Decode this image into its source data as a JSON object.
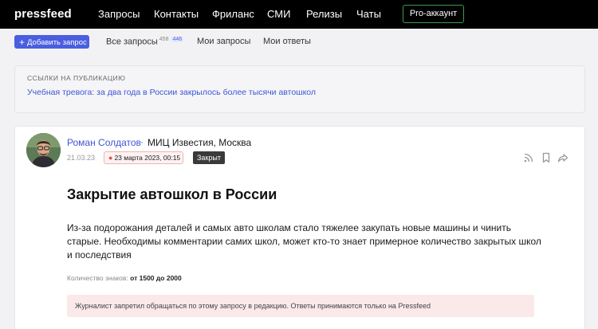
{
  "header": {
    "logo": "pressfeed",
    "nav": [
      "Запросы",
      "Контакты",
      "Фриланс",
      "СМИ",
      "Релизы",
      "Чаты"
    ],
    "pro_button": "Pro-аккаунт"
  },
  "subnav": {
    "add_button": "Добавить запрос",
    "all_requests": "Все запросы",
    "all_count": "458",
    "all_new_count": "446",
    "my_requests": "Мои запросы",
    "my_answers": "Мои ответы"
  },
  "links": {
    "heading": "ССЫЛКИ НА ПУБЛИКАЦИЮ",
    "items": [
      "Учебная тревога: за два года в России закрылось более тысячи автошкол"
    ]
  },
  "request": {
    "author": "Роман Солдатов",
    "separator": "·",
    "outlet": "МИЦ Известия, Москва",
    "date": "21.03.23",
    "deadline": "23 марта 2023, 00:15",
    "status": "Закрыт",
    "title": "Закрытие автошкол в России",
    "body": "Из-за подорожания деталей и самых авто школам стало тяжелее закупать новые машины и чинить старые. Необходимы комментарии самих школ, может кто-то знает примерное количество закрытых школ и последствия",
    "chars_label": "Количество знаков:",
    "chars_value": "от 1500 до 2000",
    "notice": "Журналист запретил обращаться по этому запросу в редакцию. Ответы принимаются только на Pressfeed"
  },
  "colors": {
    "accent": "#4a5ee0",
    "link": "#3d55d6",
    "pro_border": "#3a9a4d",
    "notice_bg": "#fbe9ea"
  },
  "icons": [
    "rss-icon",
    "bookmark-icon",
    "share-icon",
    "drop-icon",
    "plus-icon"
  ]
}
